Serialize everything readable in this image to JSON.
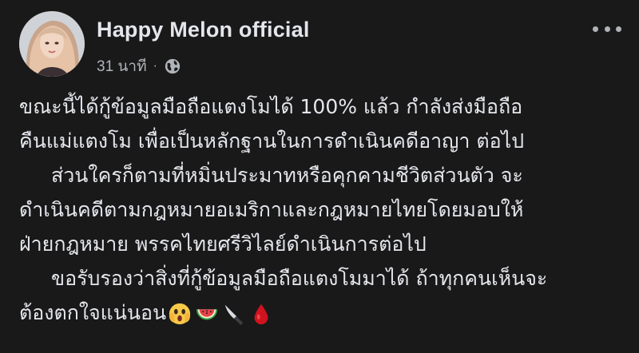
{
  "post": {
    "author": "Happy Melon official",
    "time": "31 นาที",
    "separator": "·",
    "lines": [
      "ขณะนี้ได้กู้ข้อมูลมือถือแตงโมได้ 100% แล้ว กำลังส่งมือถือ",
      "คืนแม่แตงโม เพื่อเป็นหลักฐานในการดำเนินคดีอาญา ต่อไป",
      "ส่วนใครก็ตามที่หมิ่นประมาทหรือคุกคามชีวิตส่วนตัว จะ",
      "ดำเนินคดีตามกฎหมายอเมริกาและกฎหมายไทยโดยมอบให้",
      "ฝ่ายกฎหมาย พรรคไทยศรีวิไลย์ดำเนินการต่อไป",
      "ขอรับรองว่าสิ่งที่กู้ข้อมูลมือถือแตงโมมาได้ ถ้าทุกคนเห็นจะ",
      "ต้องตกใจแน่นอน"
    ],
    "emojis": [
      "face-screaming-icon",
      "watermelon-icon",
      "knife-icon",
      "blood-drop-icon"
    ]
  },
  "colors": {
    "background": "#19191a",
    "text": "#e4e6eb",
    "secondary_text": "#b0b3b8"
  }
}
